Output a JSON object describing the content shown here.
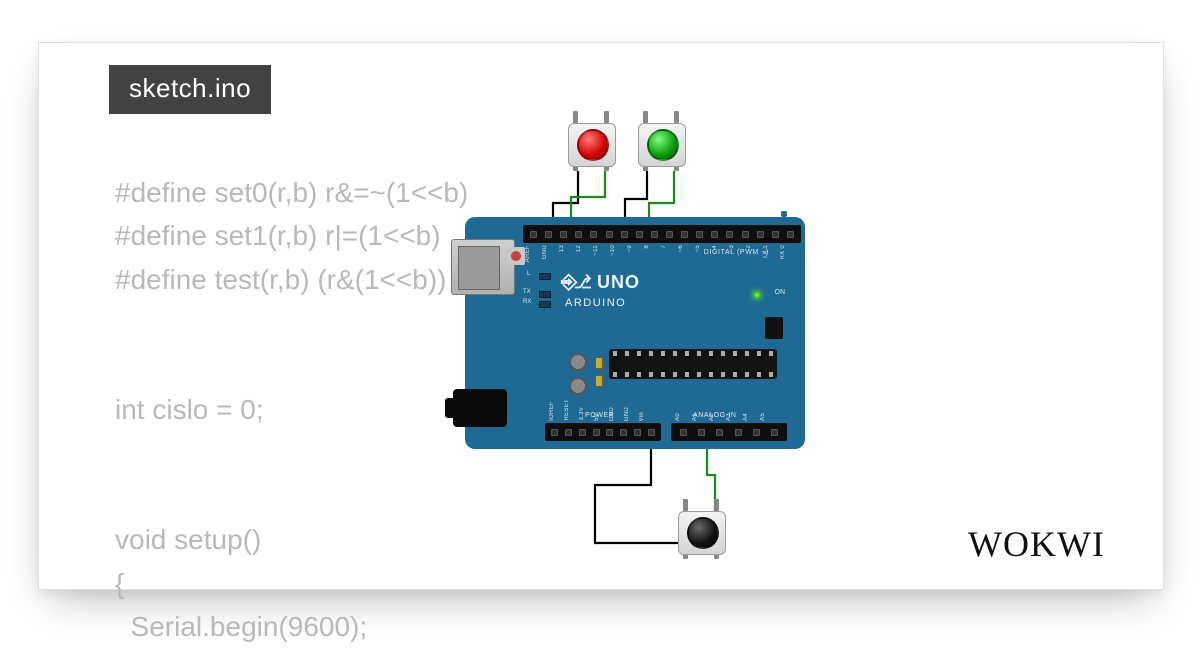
{
  "tab": {
    "filename": "sketch.ino"
  },
  "code": {
    "lines": [
      "#define set0(r,b) r&=~(1<<b)",
      "#define set1(r,b) r|=(1<<b)",
      "#define test(r,b) (r&(1<<b))",
      "",
      "",
      "int cislo = 0;",
      "",
      "",
      "void setup()",
      "{",
      "  Serial.begin(9600);"
    ]
  },
  "board": {
    "name": "UNO",
    "brand": "ARDUINO",
    "on_label": "ON",
    "led_L": "L",
    "led_TX": "TX",
    "led_RX": "RX",
    "section_digital": "DIGITAL (PWM ~)",
    "section_power": "POWER",
    "section_analog": "ANALOG IN",
    "digital_pins": [
      "AREF",
      "GND",
      "13",
      "12",
      "~11",
      "~10",
      "~9",
      "8",
      "7",
      "~6",
      "~5",
      "4",
      "~3",
      "2",
      "TX 1",
      "RX 0"
    ],
    "power_pins": [
      "IOREF",
      "RESET",
      "3.3V",
      "5V",
      "GND",
      "GND",
      "Vin"
    ],
    "analog_pins": [
      "A0",
      "A1",
      "A2",
      "A3",
      "A4",
      "A5"
    ]
  },
  "buttons": {
    "red": {
      "color": "#d40000",
      "name": "red-pushbutton"
    },
    "green": {
      "color": "#0a9a0a",
      "name": "green-pushbutton"
    },
    "black": {
      "color": "#111111",
      "name": "black-pushbutton"
    }
  },
  "wires": [
    {
      "from": "red-btn.bl",
      "to": "uno.D12",
      "color": "#000000"
    },
    {
      "from": "red-btn.br",
      "to": "uno.D11",
      "color": "#1a8a1a"
    },
    {
      "from": "green-btn.bl",
      "to": "uno.D8",
      "color": "#000000"
    },
    {
      "from": "green-btn.br",
      "to": "uno.D7",
      "color": "#1a8a1a"
    },
    {
      "from": "black-btn.tl",
      "to": "uno.Vin",
      "color": "#000000"
    },
    {
      "from": "black-btn.tr",
      "to": "uno.A2",
      "color": "#1a8a1a"
    }
  ],
  "brand_logo": "WOKWI"
}
